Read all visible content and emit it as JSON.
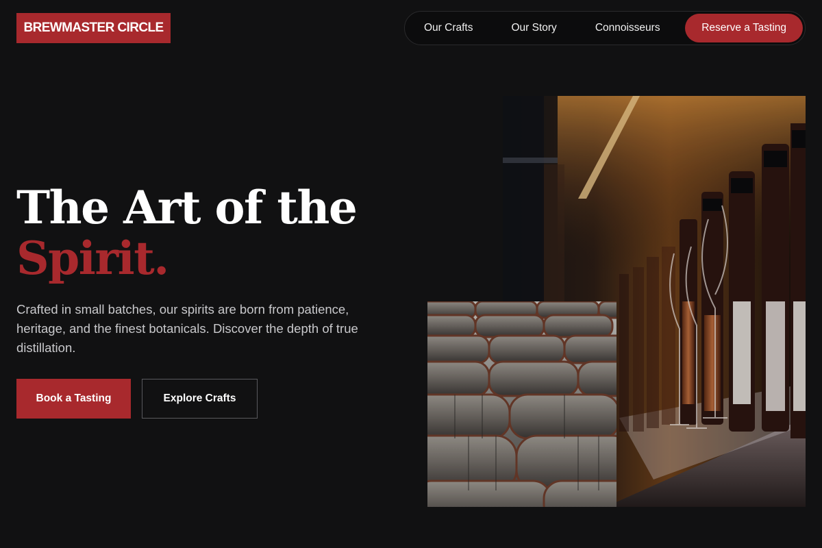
{
  "brand": {
    "name": "BREWMASTER CIRCLE",
    "color": "#a8292d"
  },
  "nav": {
    "links": [
      {
        "label": "Our Crafts"
      },
      {
        "label": "Our Story"
      },
      {
        "label": "Connoisseurs"
      }
    ],
    "cta": "Reserve a Tasting"
  },
  "hero": {
    "headline_line1": "The Art of the",
    "headline_accent": "Spirit.",
    "lede": "Crafted in small batches, our spirits are born from patience, heritage, and the finest botanicals. Discover the depth of true distillation.",
    "primary_button": "Book a Tasting",
    "secondary_button": "Explore Crafts"
  },
  "images": {
    "bottles": {
      "alt": "photo of spirit bottles and tasting glasses on a shelf"
    },
    "barrels": {
      "alt": "photo of stacked oak barrels"
    }
  },
  "colors": {
    "background": "#111112",
    "accent": "#a8292d",
    "text": "#ffffff",
    "muted_text": "#c9c9cc"
  }
}
